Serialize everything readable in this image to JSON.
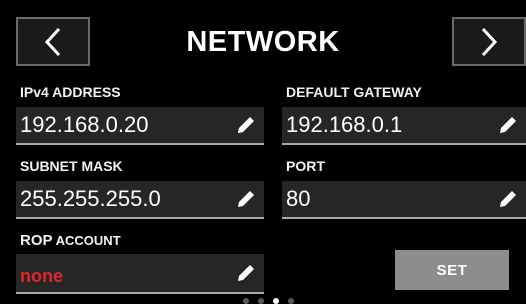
{
  "header": {
    "title": "NETWORK"
  },
  "fields": {
    "ipv4": {
      "label": "IPv4 ADDRESS",
      "value": "192.168.0.20"
    },
    "gateway": {
      "label": "DEFAULT GATEWAY",
      "value": "192.168.0.1"
    },
    "subnet": {
      "label": "SUBNET MASK",
      "value": "255.255.255.0"
    },
    "port": {
      "label": "PORT",
      "value": "80"
    },
    "rop": {
      "label_strong": "ROP",
      "label_rest": " ACCOUNT",
      "value": "none",
      "value_color": "#e4252b"
    }
  },
  "actions": {
    "set_label": "SET"
  },
  "pagination": {
    "pages": 4,
    "active_index": 2
  },
  "colors": {
    "background": "#000000",
    "field_bg": "#262626",
    "set_button_bg": "#8d8d8d"
  },
  "icons": {
    "prev": "chevron-left-icon",
    "next": "chevron-right-icon",
    "edit": "pencil-icon"
  }
}
